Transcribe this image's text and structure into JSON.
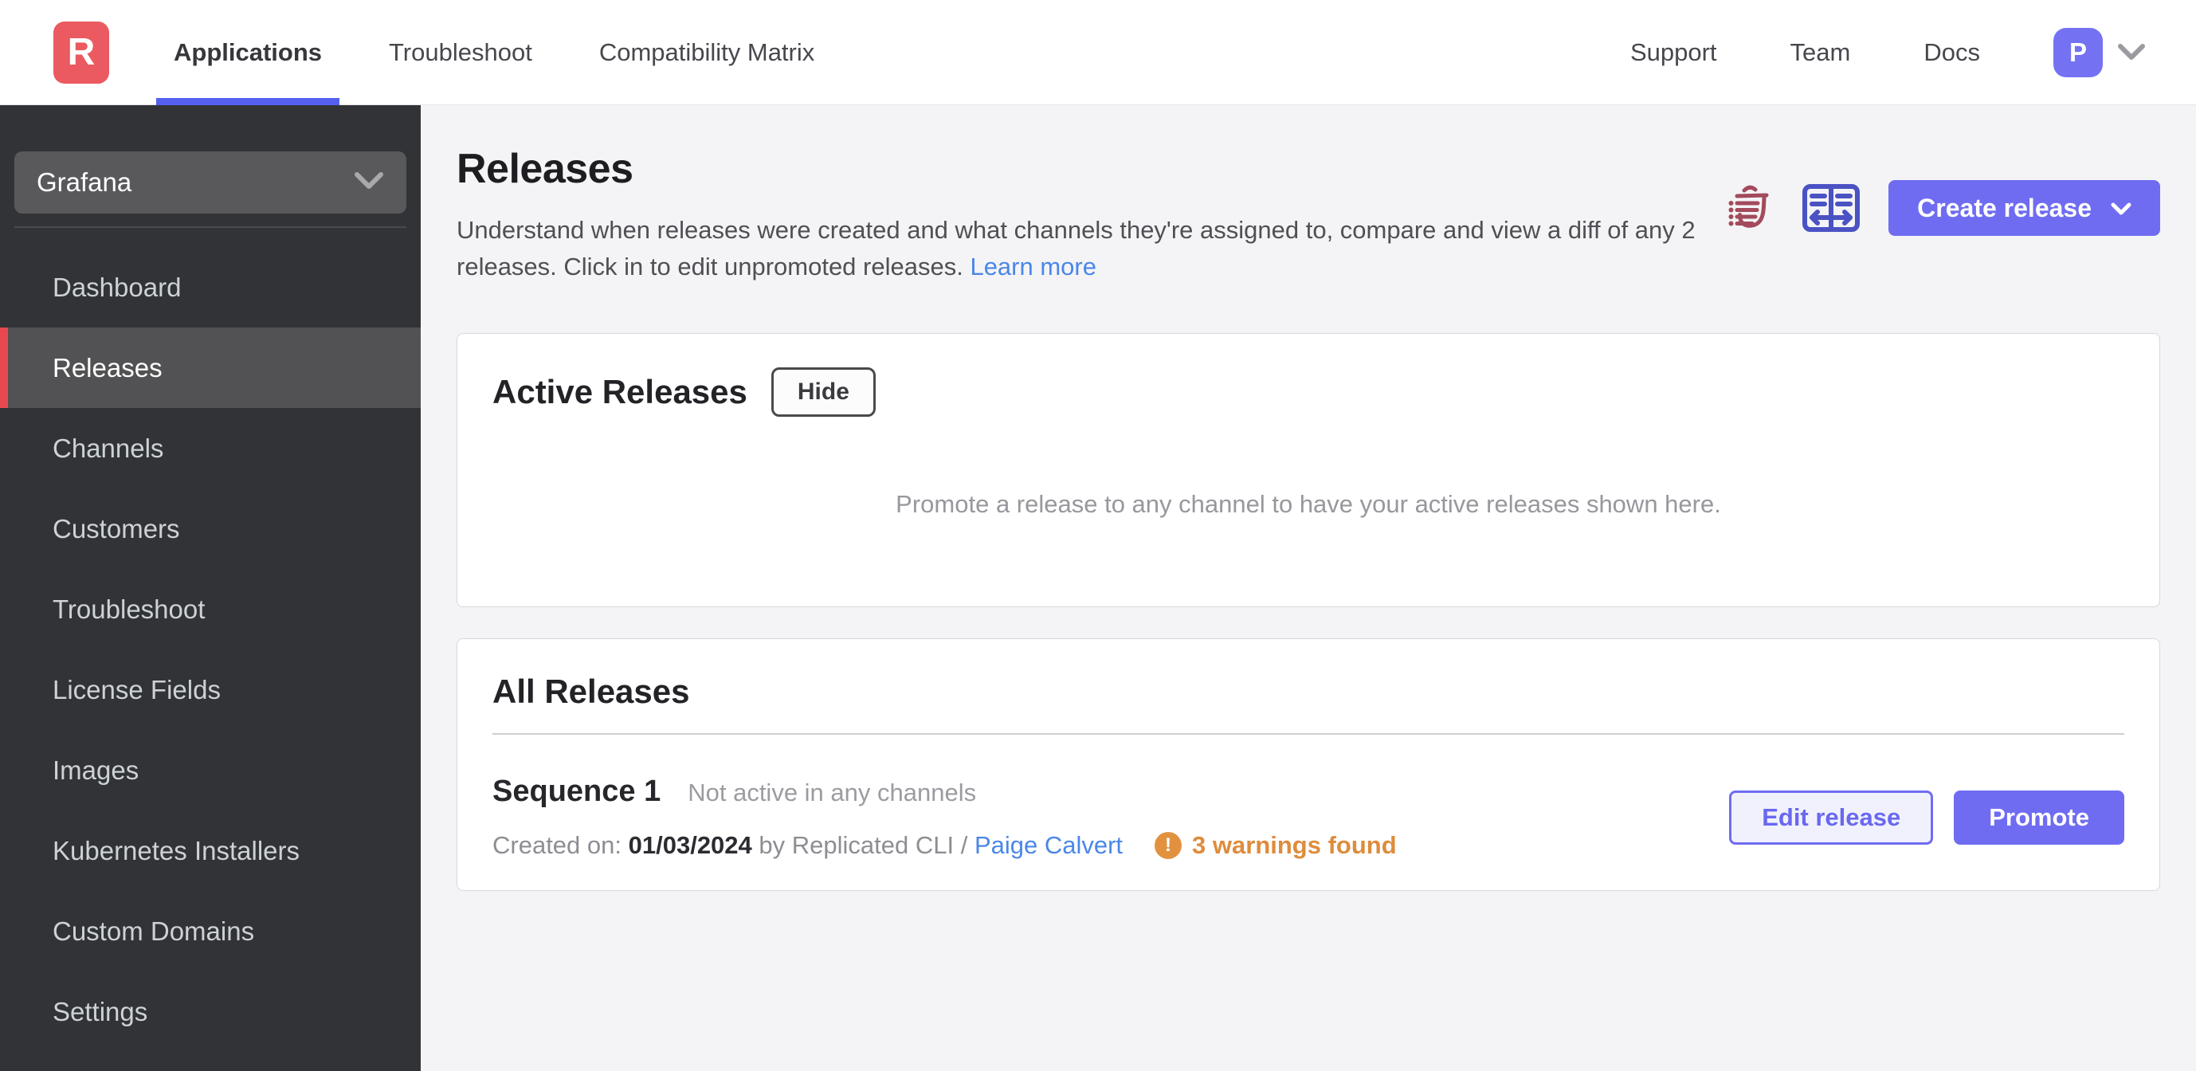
{
  "colors": {
    "brand_red": "#ea5a60",
    "accent_purple": "#6f6cf2",
    "nav_active_underline": "#5660ee",
    "link_blue": "#4a87e8",
    "warning_orange": "#de8c3c",
    "sidebar_bg": "#323336",
    "sidebar_active_accent": "#e8494f",
    "trash_icon_red": "#a34a5c",
    "compare_icon_indigo": "#4a52c4"
  },
  "topnav": {
    "logo_letter": "R",
    "tabs": [
      {
        "label": "Applications",
        "active": true
      },
      {
        "label": "Troubleshoot",
        "active": false
      },
      {
        "label": "Compatibility Matrix",
        "active": false
      }
    ],
    "links": [
      "Support",
      "Team",
      "Docs"
    ],
    "avatar_initial": "P",
    "icons": {
      "avatar_menu": "chevron-down-icon"
    }
  },
  "sidebar": {
    "app_selector": {
      "value": "Grafana",
      "icon": "chevron-down-icon"
    },
    "items": [
      {
        "label": "Dashboard",
        "active": false
      },
      {
        "label": "Releases",
        "active": true
      },
      {
        "label": "Channels",
        "active": false
      },
      {
        "label": "Customers",
        "active": false
      },
      {
        "label": "Troubleshoot",
        "active": false
      },
      {
        "label": "License Fields",
        "active": false
      },
      {
        "label": "Images",
        "active": false
      },
      {
        "label": "Kubernetes Installers",
        "active": false
      },
      {
        "label": "Custom Domains",
        "active": false
      },
      {
        "label": "Settings",
        "active": false
      }
    ]
  },
  "page": {
    "title": "Releases",
    "description": "Understand when releases were created and what channels they're assigned to, compare and view a diff of any 2 releases. Click in to edit unpromoted releases.",
    "learn_more": "Learn more",
    "actions": {
      "create_release": "Create release",
      "icons": [
        "trash-list-icon",
        "compare-columns-icon",
        "chevron-down-icon"
      ]
    }
  },
  "active_releases": {
    "title": "Active Releases",
    "hide_button": "Hide",
    "empty_text": "Promote a release to any channel to have your active releases shown here."
  },
  "all_releases": {
    "title": "All Releases",
    "releases": [
      {
        "name": "Sequence 1",
        "channel_status": "Not active in any channels",
        "created_label": "Created on:",
        "created_date": "01/03/2024",
        "created_via": "by Replicated CLI /",
        "created_by": "Paige Calvert",
        "warnings": "3 warnings found",
        "actions": {
          "edit": "Edit release",
          "promote": "Promote"
        }
      }
    ]
  }
}
